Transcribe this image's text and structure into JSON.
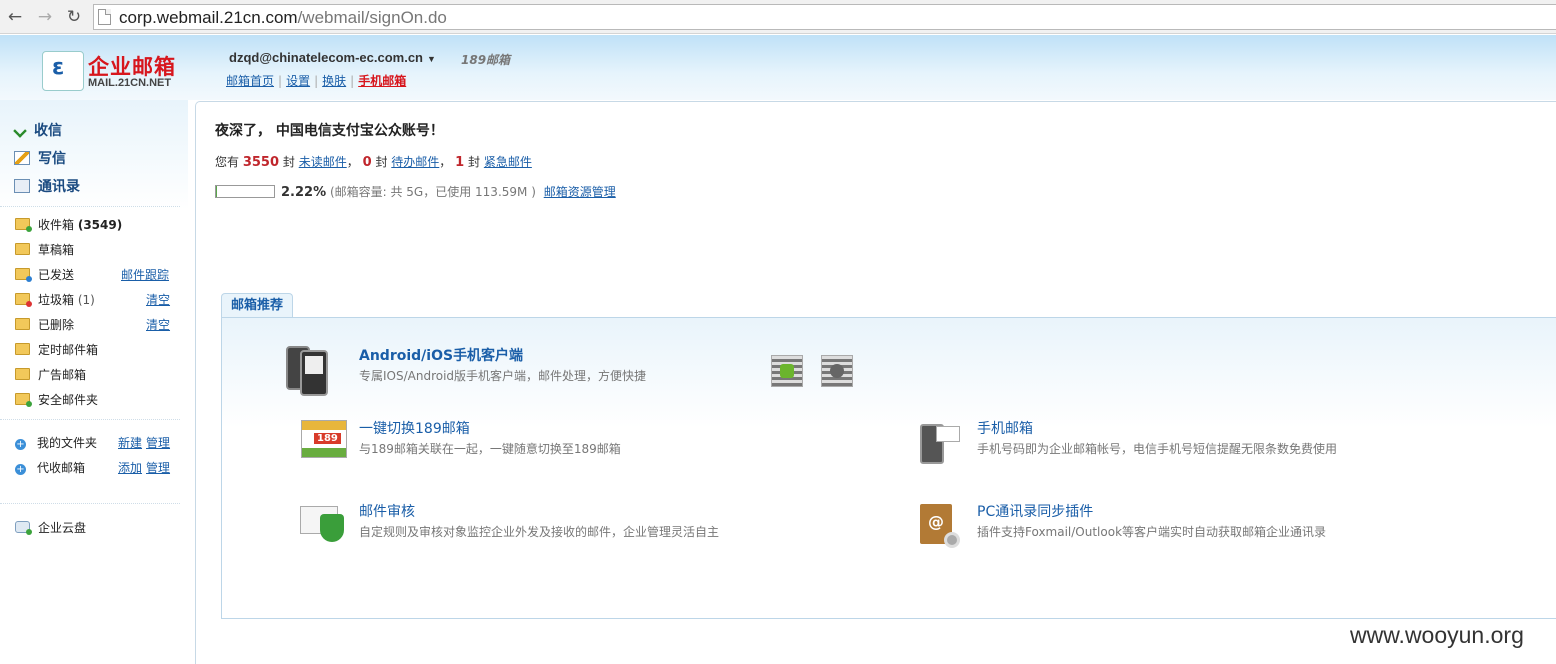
{
  "browser": {
    "url_host": "corp.webmail.21cn.com",
    "url_path": "/webmail/signOn.do"
  },
  "header": {
    "logo_title": "企业邮箱",
    "logo_sub": "MAIL.21CN.NET",
    "account": "dzqd@chinatelecom-ec.com.cn",
    "brand189": "189邮箱",
    "nav": [
      "邮箱首页",
      "设置",
      "换肤",
      "手机邮箱"
    ]
  },
  "sidebar": {
    "main_items": [
      "收信",
      "写信",
      "通讯录"
    ],
    "folders": [
      {
        "label": "收件箱",
        "count": "(3549)"
      },
      {
        "label": "草稿箱"
      },
      {
        "label": "已发送",
        "action": "邮件跟踪"
      },
      {
        "label": "垃圾箱",
        "count": "(1)",
        "action": "清空"
      },
      {
        "label": "已删除",
        "action": "清空"
      },
      {
        "label": "定时邮件箱"
      },
      {
        "label": "广告邮箱"
      },
      {
        "label": "安全邮件夹"
      }
    ],
    "custom": [
      {
        "label": "我的文件夹",
        "actions": [
          "新建",
          "管理"
        ]
      },
      {
        "label": "代收邮箱",
        "actions": [
          "添加",
          "管理"
        ]
      }
    ],
    "cloud": "企业云盘"
  },
  "main": {
    "greeting": "夜深了， 中国电信支付宝公众账号！",
    "stats": {
      "prefix": "您有",
      "unread": "3550",
      "unit": "封",
      "unread_link": "未读邮件",
      "todo": "0",
      "todo_link": "待办邮件",
      "urgent": "1",
      "urgent_link": "紧急邮件",
      "sep": "，"
    },
    "quota": {
      "fraction": 0.0222,
      "percent": "2.22%",
      "detail": "(邮箱容量: 共 5G，已使用 113.59M )",
      "link": "邮箱资源管理"
    }
  },
  "recommend": {
    "tab": "邮箱推荐",
    "items": [
      {
        "title": "Android/iOS手机客户端",
        "desc": "专属IOS/Android版手机客户端，邮件处理，方便快捷"
      },
      {
        "title": "一键切换189邮箱",
        "desc": "与189邮箱关联在一起，一键随意切换至189邮箱"
      },
      {
        "title": "手机邮箱",
        "desc": "手机号码即为企业邮箱帐号，电信手机号短信提醒无限条数免费使用"
      },
      {
        "title": "邮件审核",
        "desc": "自定规则及审核对象监控企业外发及接收的邮件，企业管理灵活自主"
      },
      {
        "title": "PC通讯录同步插件",
        "desc": "插件支持Foxmail/Outlook等客户端实时自动获取邮箱企业通讯录"
      }
    ],
    "calendar_badge": "189"
  },
  "watermark": "www.wooyun.org"
}
